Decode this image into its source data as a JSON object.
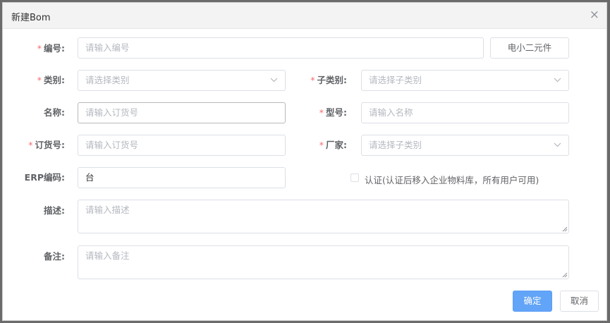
{
  "dialog": {
    "title": "新建Bom",
    "close_icon": "×"
  },
  "form": {
    "number": {
      "label": "编号:",
      "required": "*",
      "placeholder": "请输入编号",
      "side_button": "电小二元件"
    },
    "category": {
      "label": "类别:",
      "required": "*",
      "placeholder": "请选择类别"
    },
    "subcategory": {
      "label": "子类别:",
      "required": "*",
      "placeholder": "请选择子类别"
    },
    "name": {
      "label": "名称:",
      "placeholder": "请输入订货号"
    },
    "model": {
      "label": "型号:",
      "required": "*",
      "placeholder": "请输入名称"
    },
    "order_no": {
      "label": "订货号:",
      "required": "*",
      "placeholder": "请输入订货号"
    },
    "manufacturer": {
      "label": "厂家:",
      "required": "*",
      "placeholder": "请选择子类别"
    },
    "erp_code": {
      "label": "ERP编码:",
      "value": "台"
    },
    "certify": {
      "label": "认证(认证后移入企业物料库，所有用户可用)",
      "checked": false
    },
    "description": {
      "label": "描述:",
      "placeholder": "请输入描述"
    },
    "remark": {
      "label": "备注:",
      "placeholder": "请输入备注"
    }
  },
  "footer": {
    "confirm_label": "确定",
    "cancel_label": "取消"
  },
  "colors": {
    "required": "#f56c6c",
    "primary": "#62a4f7",
    "border": "#dcdfe6",
    "placeholder": "#b4b8bf"
  },
  "icons": {
    "chevron": "chevron-down-icon",
    "close": "close-icon"
  }
}
